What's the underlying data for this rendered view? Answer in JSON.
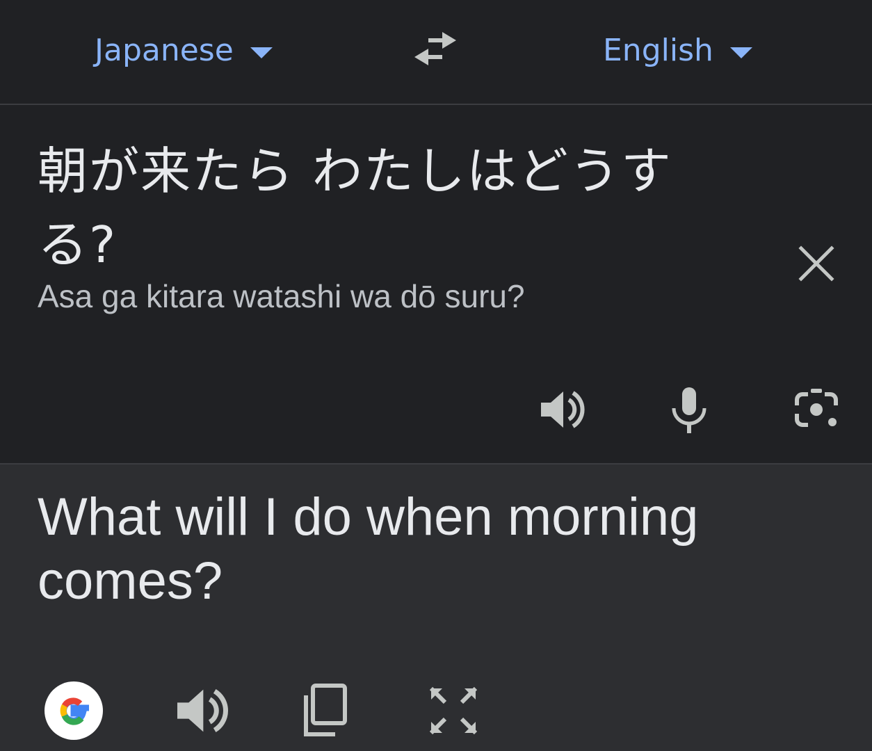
{
  "header": {
    "source_language": "Japanese",
    "target_language": "English",
    "swap_icon": "swap-horiz-icon"
  },
  "source": {
    "text": "朝が来たら わたしはどうする?",
    "transliteration": "Asa ga kitara watashi wa dō suru?",
    "tools": [
      "speaker-icon",
      "microphone-icon",
      "camera-lens-icon"
    ],
    "clear_icon": "close-icon"
  },
  "target": {
    "text": "What will I do when morning comes?",
    "tools": [
      "google-logo",
      "speaker-icon",
      "copy-icon",
      "fullscreen-icon"
    ]
  },
  "colors": {
    "background": "#202124",
    "target_background": "#2d2e31",
    "accent": "#8ab4f8",
    "text_primary": "#e8eaed",
    "text_secondary": "#bdc1c6",
    "icon": "#c4c7c5",
    "divider": "#3c3d41"
  }
}
